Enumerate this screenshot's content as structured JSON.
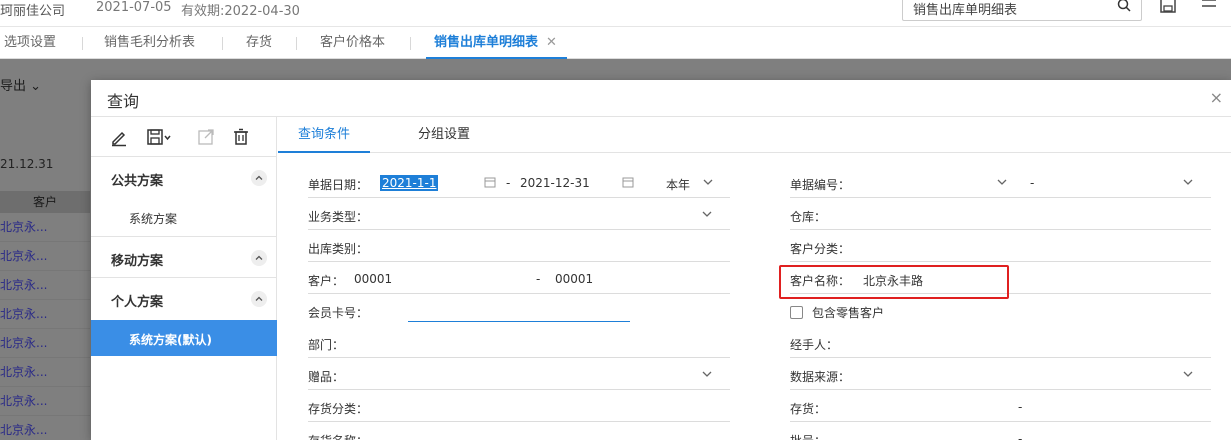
{
  "header": {
    "company": "珂丽佳公司",
    "date": "2021-07-05",
    "validity": "有效期:2022-04-30",
    "search_value": "销售出库单明细表"
  },
  "tabs": [
    {
      "label": "选项设置"
    },
    {
      "label": "销售毛利分析表"
    },
    {
      "label": "存货"
    },
    {
      "label": "客户价格本"
    },
    {
      "label": "销售出库单明细表",
      "close": "✕"
    }
  ],
  "background": {
    "export_label": "导出",
    "date_fragment": "21.12.31",
    "column_header": "客户",
    "rows": [
      "北京永...",
      "北京永...",
      "北京永...",
      "北京永...",
      "北京永...",
      "北京永...",
      "北京永...",
      "北京永..."
    ]
  },
  "dialog": {
    "title": "查询",
    "close": "×",
    "left": {
      "public_scheme": "公共方案",
      "public_item": "系统方案",
      "mobile_scheme": "移动方案",
      "personal_scheme": "个人方案",
      "personal_item": "系统方案(默认)"
    },
    "right_tabs": [
      "查询条件",
      "分组设置"
    ],
    "fields_left": {
      "doc_date_label": "单据日期：",
      "doc_date_from": "2021-1-1",
      "doc_date_sep": "-",
      "doc_date_to": "2021-12-31",
      "doc_date_preset": "本年",
      "biz_type_label": "业务类型：",
      "outbound_type_label": "出库类别：",
      "customer_label": "客户：",
      "customer_from": "00001",
      "customer_sep": "-",
      "customer_to": "00001",
      "member_card_label": "会员卡号：",
      "dept_label": "部门：",
      "gift_label": "赠品：",
      "inv_class_label": "存货分类：",
      "inv_name_label": "存货名称："
    },
    "fields_right": {
      "doc_no_label": "单据编号：",
      "doc_no_sep": "-",
      "warehouse_label": "仓库：",
      "cust_class_label": "客户分类：",
      "cust_name_label": "客户名称：",
      "cust_name_value": "北京永丰路",
      "retail_label": "包含零售客户",
      "handler_label": "经手人：",
      "data_source_label": "数据来源：",
      "inventory_label": "存货：",
      "inventory_sep": "-",
      "batch_label": "批号：",
      "batch_sep": "-"
    }
  },
  "colors": {
    "accent": "#1e7fd8",
    "highlight_box": "#e02020",
    "active_item_bg": "#3a8ee6",
    "overlay": "#7f7f7f"
  },
  "icons": [
    "search-icon",
    "save-icon",
    "filter-icon",
    "edit-icon",
    "save-dropdown-icon",
    "export-icon",
    "delete-icon",
    "calendar-icon",
    "chevron-down-icon",
    "chevron-up-icon"
  ]
}
